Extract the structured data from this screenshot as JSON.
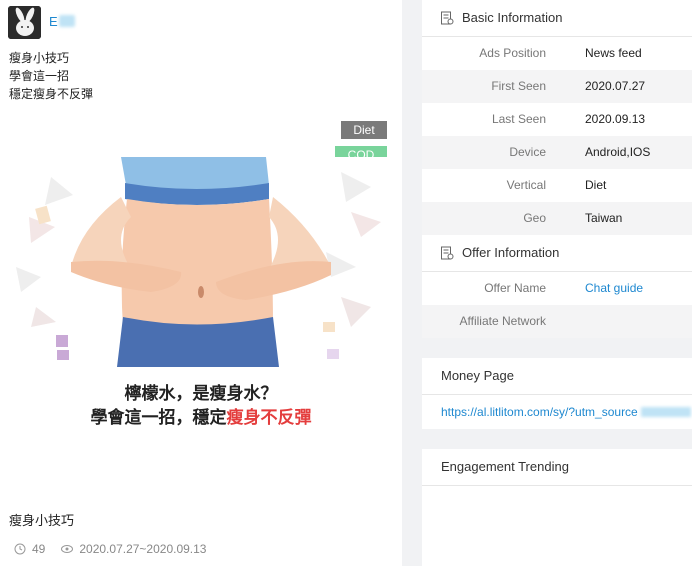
{
  "ad": {
    "advertiser_name": "E",
    "text_lines": [
      "瘦身小技巧",
      "學會這一招",
      "穩定瘦身不反彈"
    ],
    "tags": [
      "Diet",
      "COD"
    ],
    "creative_caption_line1": "檸檬水，是瘦身水？",
    "creative_caption_line2_prefix": "學會這一招，穩定",
    "creative_caption_line2_highlight": "瘦身不反彈",
    "bottom_caption": "瘦身小技巧",
    "likes": "49",
    "seen_range": "2020.07.27~2020.09.13",
    "icons": {
      "likes": "clock-like-icon",
      "seen": "eye-icon"
    }
  },
  "basic_info": {
    "title": "Basic Information",
    "rows": [
      {
        "label": "Ads Position",
        "value": "News feed"
      },
      {
        "label": "First Seen",
        "value": "2020.07.27"
      },
      {
        "label": "Last Seen",
        "value": "2020.09.13"
      },
      {
        "label": "Device",
        "value": "Android,IOS"
      },
      {
        "label": "Vertical",
        "value": "Diet"
      },
      {
        "label": "Geo",
        "value": "Taiwan"
      }
    ]
  },
  "offer_info": {
    "title": "Offer Information",
    "rows": [
      {
        "label": "Offer Name",
        "value": "Chat guide"
      },
      {
        "label": "Affiliate Network",
        "value": ""
      }
    ]
  },
  "money_page": {
    "title": "Money Page",
    "url": "https://al.litlitom.com/sy/?utm_source"
  },
  "engagement": {
    "title": "Engagement Trending"
  },
  "colors": {
    "link": "#1e88d0",
    "highlight_red": "#e43d3d",
    "tag_diet": "#7a7a7a",
    "tag_cod": "#79d49b"
  }
}
